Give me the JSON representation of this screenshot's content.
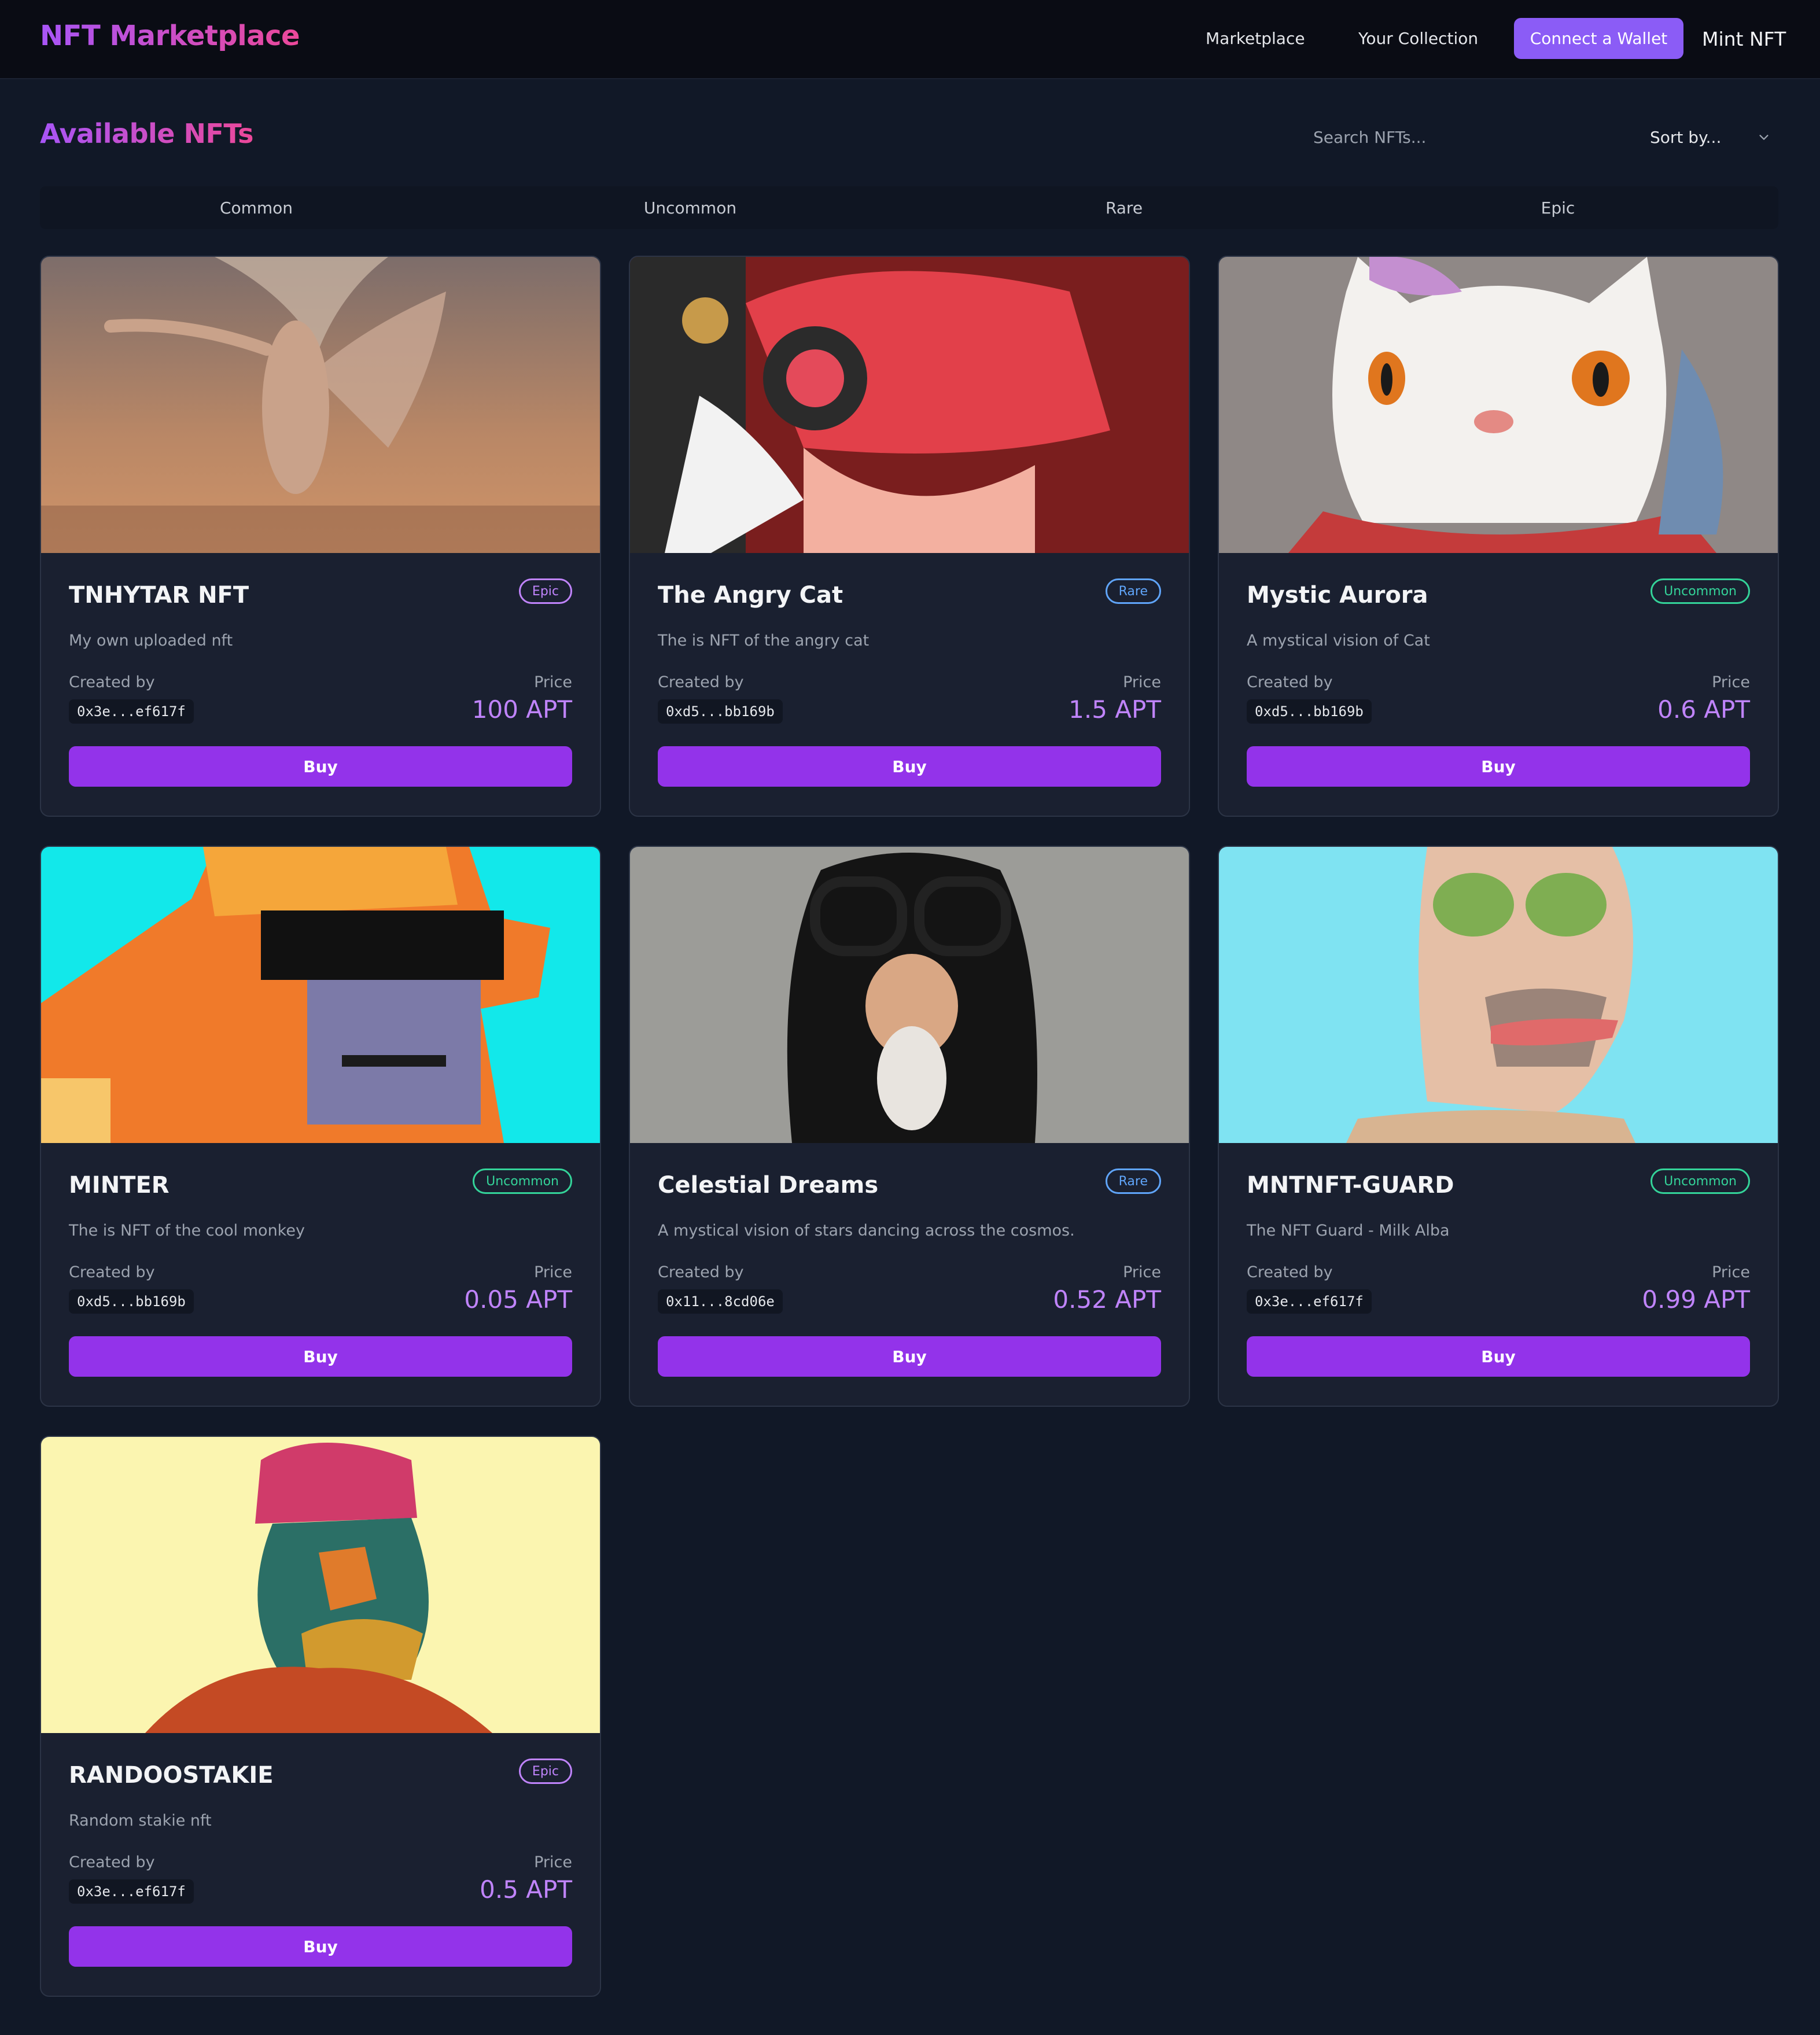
{
  "nav": {
    "brand": "NFT Marketplace",
    "marketplace": "Marketplace",
    "collection": "Your Collection",
    "connect": "Connect a Wallet",
    "mint": "Mint NFT"
  },
  "main": {
    "title": "Available NFTs",
    "search_placeholder": "Search NFTs...",
    "sort_label": "Sort by...",
    "tabs": [
      "Common",
      "Uncommon",
      "Rare",
      "Epic"
    ]
  },
  "labels": {
    "created_by": "Created by",
    "price": "Price",
    "buy": "Buy"
  },
  "cards": [
    {
      "title": "TNHYTAR NFT",
      "rarity": "Epic",
      "desc": "My own uploaded nft",
      "creator": "0x3e...ef617f",
      "price": "100 APT"
    },
    {
      "title": "The Angry Cat",
      "rarity": "Rare",
      "desc": "The is NFT of the angry cat",
      "creator": "0xd5...bb169b",
      "price": "1.5 APT"
    },
    {
      "title": "Mystic Aurora",
      "rarity": "Uncommon",
      "desc": "A mystical vision of Cat",
      "creator": "0xd5...bb169b",
      "price": "0.6 APT"
    },
    {
      "title": "MINTER",
      "rarity": "Uncommon",
      "desc": "The is NFT of the cool monkey",
      "creator": "0xd5...bb169b",
      "price": "0.05 APT"
    },
    {
      "title": "Celestial Dreams",
      "rarity": "Rare",
      "desc": "A mystical vision of stars dancing across the cosmos.",
      "creator": "0x11...8cd06e",
      "price": "0.52 APT"
    },
    {
      "title": "MNTNFT-GUARD",
      "rarity": "Uncommon",
      "desc": "The NFT Guard - Milk Alba",
      "creator": "0x3e...ef617f",
      "price": "0.99 APT"
    },
    {
      "title": "RANDOOSTAKIE",
      "rarity": "Epic",
      "desc": "Random stakie nft",
      "creator": "0x3e...ef617f",
      "price": "0.5 APT"
    }
  ],
  "colors": {
    "background": "#111827",
    "accent": "#9333ea",
    "brand_gradient": [
      "#a855f7",
      "#ec4899"
    ],
    "epic": "#c084fc",
    "rare": "#60a5fa",
    "uncommon": "#34d399"
  }
}
